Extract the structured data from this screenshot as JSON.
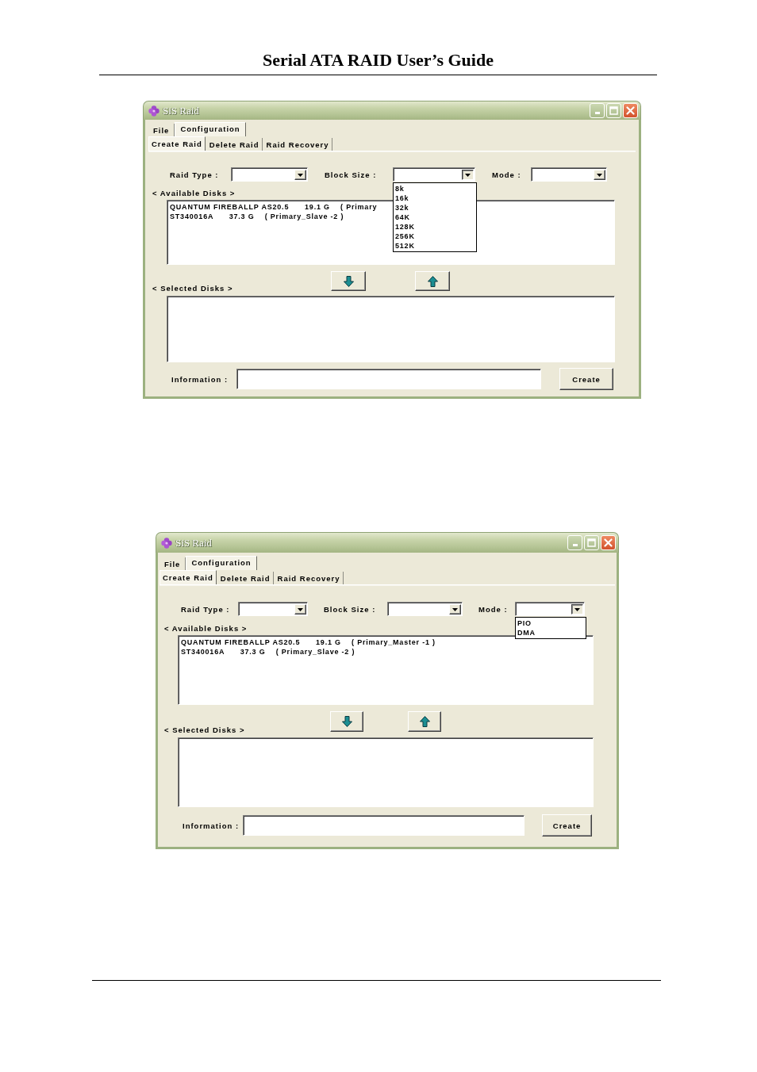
{
  "page_header": {
    "title": "Serial ATA RAID User’s Guide"
  },
  "screenshots": [
    {
      "window": {
        "title": "SiS Raid"
      },
      "menu_tabs": [
        {
          "label": "File",
          "selected": false
        },
        {
          "label": "Configuration",
          "selected": true
        }
      ],
      "sub_tabs": [
        {
          "label": "Create Raid",
          "selected": true
        },
        {
          "label": "Delete Raid",
          "selected": false
        },
        {
          "label": "Raid Recovery",
          "selected": false
        }
      ],
      "selectors": [
        {
          "label": "Raid Type :",
          "expanded": false
        },
        {
          "label": "Block Size :",
          "expanded": true,
          "options": [
            "8k",
            "16k",
            "32k",
            "64K",
            "128K",
            "256K",
            "512K"
          ]
        },
        {
          "label": "Mode :",
          "expanded": false
        }
      ],
      "available_disks": {
        "label": "< Available Disks >",
        "items": [
          "QUANTUM FIREBALLP AS20.5      19.1 G    ( Primary",
          "ST340016A      37.3 G    ( Primary_Slave -2 )"
        ]
      },
      "selected_disks": {
        "label": "< Selected Disks >"
      },
      "information": {
        "label": "Information :"
      },
      "buttons": [
        "Create"
      ]
    },
    {
      "window": {
        "title": "SiS Raid"
      },
      "menu_tabs": [
        {
          "label": "File",
          "selected": false
        },
        {
          "label": "Configuration",
          "selected": true
        }
      ],
      "sub_tabs": [
        {
          "label": "Create Raid",
          "selected": true
        },
        {
          "label": "Delete Raid",
          "selected": false
        },
        {
          "label": "Raid Recovery",
          "selected": false
        }
      ],
      "selectors": [
        {
          "label": "Raid Type :",
          "expanded": false
        },
        {
          "label": "Block Size :",
          "expanded": false
        },
        {
          "label": "Mode :",
          "expanded": true,
          "options": [
            "PIO",
            "DMA"
          ]
        }
      ],
      "available_disks": {
        "label": "< Available Disks >",
        "items": [
          "QUANTUM FIREBALLP AS20.5      19.1 G    ( Primary_Master -1 )",
          "ST340016A      37.3 G    ( Primary_Slave -2 )"
        ]
      },
      "selected_disks": {
        "label": "< Selected Disks >"
      },
      "information": {
        "label": "Information :"
      },
      "buttons": [
        "Create"
      ]
    }
  ]
}
